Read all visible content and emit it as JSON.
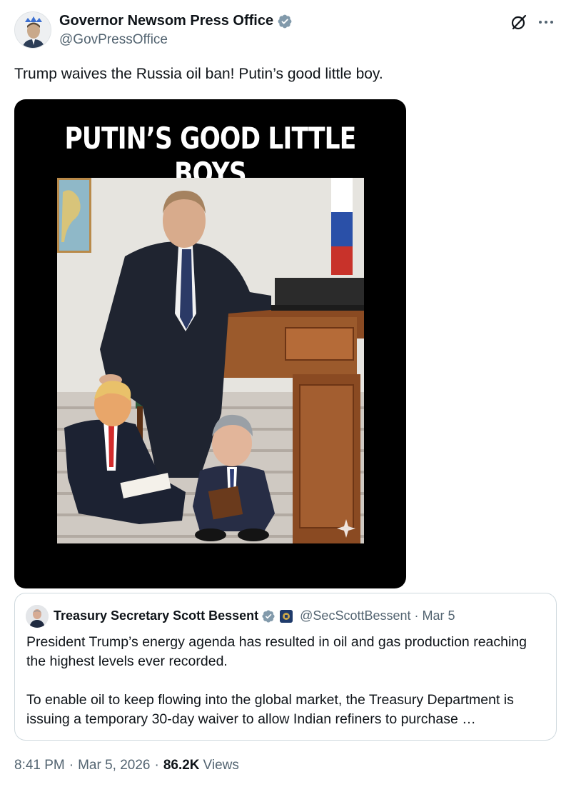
{
  "tweet": {
    "display_name": "Governor Newsom Press Office",
    "handle": "@GovPressOffice",
    "text": "Trump waives the Russia oil ban! Putin’s good little boy.",
    "verified_color": "#829aab"
  },
  "media": {
    "title": "PUTIN’S GOOD LITTLE BOYS"
  },
  "quoted_tweet": {
    "display_name": "Treasury Secretary Scott Bessent",
    "handle": "@SecScottBessent",
    "separator": "·",
    "date": "Mar 5",
    "paragraph_1": "President Trump’s energy agenda has resulted in oil and gas production reaching the highest levels ever recorded.",
    "paragraph_2": "To enable oil to keep flowing into the global market, the Treasury Department is issuing a temporary 30-day waiver to allow Indian refiners to purchase …"
  },
  "meta": {
    "time": "8:41 PM",
    "date": "Mar 5, 2026",
    "separator": "·",
    "views_count": "86.2K",
    "views_label": "Views"
  },
  "colors": {
    "text_primary": "#0f1419",
    "text_secondary": "#536471",
    "border": "#cfd9de"
  },
  "icons": [
    "verified-badge-icon",
    "grok-icon",
    "more-options-icon",
    "treasury-seal-icon"
  ]
}
